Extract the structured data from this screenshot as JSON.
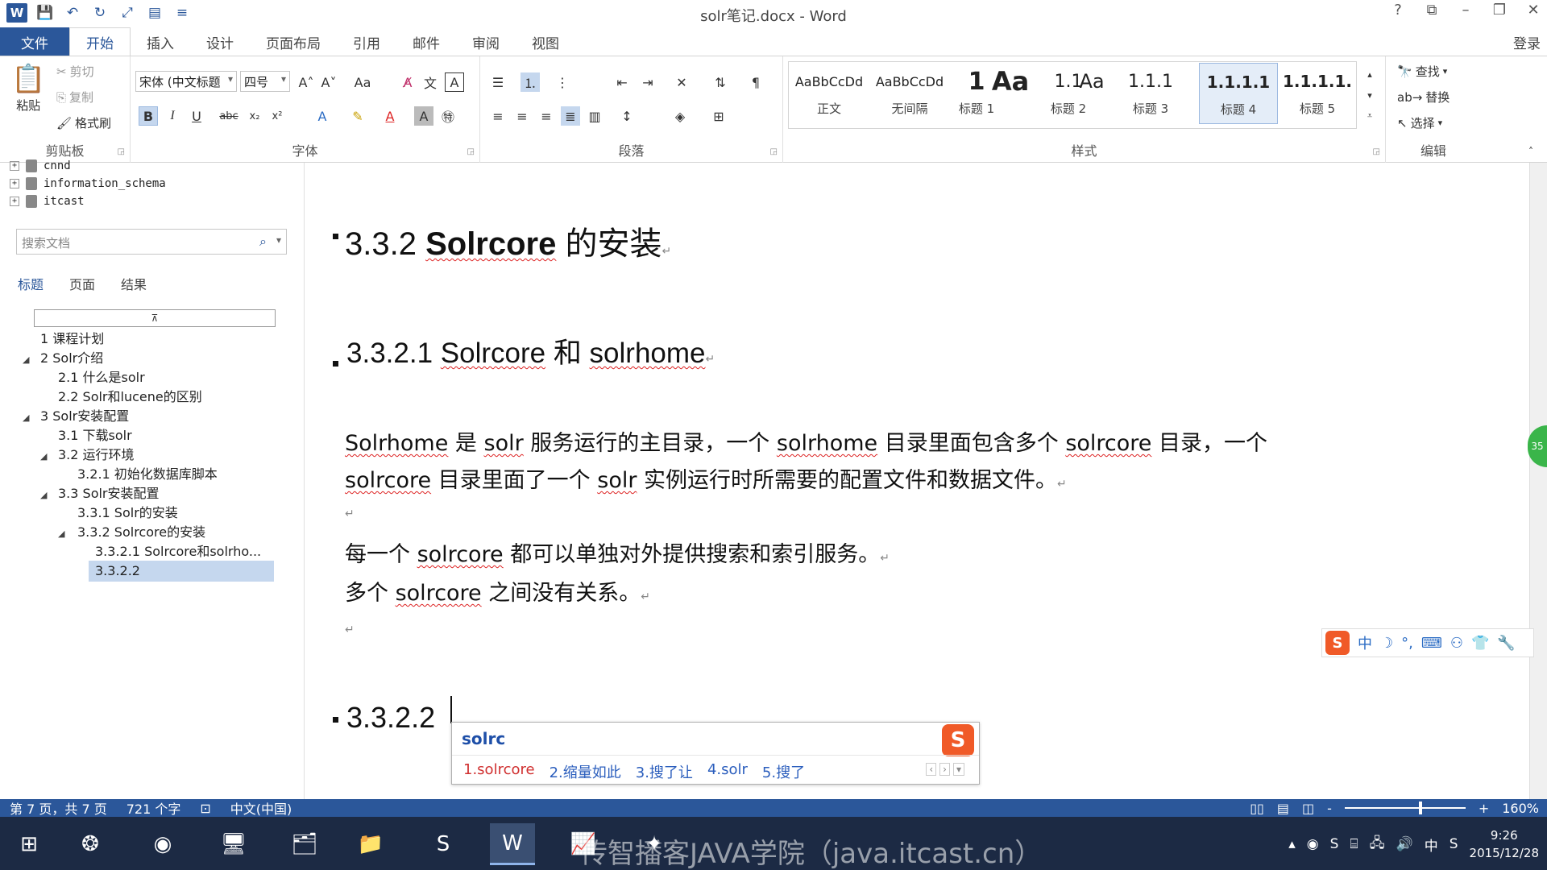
{
  "window": {
    "title": "solr笔记.docx - Word",
    "controls": [
      "?",
      "⧉",
      "–",
      "❐",
      "✕"
    ]
  },
  "ribbon_tabs": [
    "文件",
    "开始",
    "插入",
    "设计",
    "页面布局",
    "引用",
    "邮件",
    "审阅",
    "视图"
  ],
  "login": "登录",
  "clipboard": {
    "paste": "粘贴",
    "cut": "剪切",
    "copy": "复制",
    "format_painter": "格式刷",
    "label": "剪贴板"
  },
  "font": {
    "name": "宋体 (中文标题",
    "size": "四号",
    "label": "字体"
  },
  "paragraph": {
    "label": "段落"
  },
  "styles": {
    "label": "样式",
    "items": [
      {
        "sample": "AaBbCcDd",
        "name": "正文"
      },
      {
        "sample": "AaBbCcDd",
        "name": "无间隔"
      },
      {
        "sample": "1",
        "name": "标题 1"
      },
      {
        "sample": "Aa",
        "name": ""
      },
      {
        "sample": "1.1",
        "name": "标题 2"
      },
      {
        "sample": "Aa",
        "name": ""
      },
      {
        "sample": "1.1.1",
        "name": "标题 3"
      },
      {
        "sample": "1.1.1.1",
        "name": "标题 4"
      },
      {
        "sample": "1.1.1.1.",
        "name": "标题 5"
      }
    ]
  },
  "editing": {
    "find": "查找",
    "replace": "替换",
    "select": "选择",
    "label": "编辑"
  },
  "db_tree": [
    "cnnd",
    "information_schema",
    "itcast"
  ],
  "nav": {
    "search_placeholder": "搜索文档",
    "tabs": [
      "标题",
      "页面",
      "结果"
    ],
    "items": [
      {
        "text": "1 课程计划"
      },
      {
        "text": "2 Solr介绍"
      },
      {
        "text": "2.1 什么是solr"
      },
      {
        "text": "2.2 Solr和lucene的区别"
      },
      {
        "text": "3 Solr安装配置"
      },
      {
        "text": "3.1 下载solr"
      },
      {
        "text": "3.2 运行环境"
      },
      {
        "text": "3.2.1 初始化数据库脚本"
      },
      {
        "text": "3.3 Solr安装配置"
      },
      {
        "text": "3.3.1 Solr的安装"
      },
      {
        "text": "3.3.2 Solrcore的安装"
      },
      {
        "text": "3.3.2.1 Solrcore和solrho..."
      },
      {
        "text": "3.3.2.2"
      }
    ]
  },
  "doc": {
    "h3": {
      "num": "3.3.2 ",
      "w1": "Solrcore",
      "rest": " 的安装"
    },
    "h4": {
      "num": "3.3.2.1 ",
      "w1": "Solrcore",
      "mid": " 和 ",
      "w2": "solrhome"
    },
    "p1_line1": {
      "w1": "Solrhome",
      "t1": " 是 ",
      "w2": "solr",
      "t2": " 服务运行的主目录，一个 ",
      "w3": "solrhome",
      "t3": " 目录里面包含多个 ",
      "w4": "solrcore",
      "t4": " 目录，一个"
    },
    "p1_line2": {
      "w1": "solrcore",
      "t1": " 目录里面了一个 ",
      "w2": "solr",
      "t2": " 实例运行时所需要的配置文件和数据文件。"
    },
    "p2": {
      "t0": "每一个 ",
      "w1": "solrcore",
      "t1": " 都可以单独对外提供搜索和索引服务。"
    },
    "p3": {
      "t0": "多个 ",
      "w1": "solrcore",
      "t1": " 之间没有关系。"
    },
    "h4b": "3.3.2.2",
    "para_mark": "↵"
  },
  "ime": {
    "input": "solrc",
    "candidates": [
      "1.solrcore",
      "2.缩量如此",
      "3.搜了让",
      "4.solr",
      "5.搜了"
    ]
  },
  "imebar": [
    "中",
    "☽",
    "°,",
    "⌨",
    "⚇",
    "👕",
    "🔧"
  ],
  "status": {
    "page": "第 7 页，共 7 页",
    "words": "721 个字",
    "lang": "中文(中国)",
    "zoom": "160%",
    "zoom_minus": "-",
    "zoom_plus": "+"
  },
  "taskbar": {
    "watermark": "传智播客JAVA学院（java.itcast.cn）",
    "time": "9:26",
    "date": "2015/12/28",
    "ime_indicator": "中"
  },
  "colors": {
    "accent": "#2b579a",
    "spell": "#dd2222",
    "nav_selected": "#c5d7ee"
  }
}
